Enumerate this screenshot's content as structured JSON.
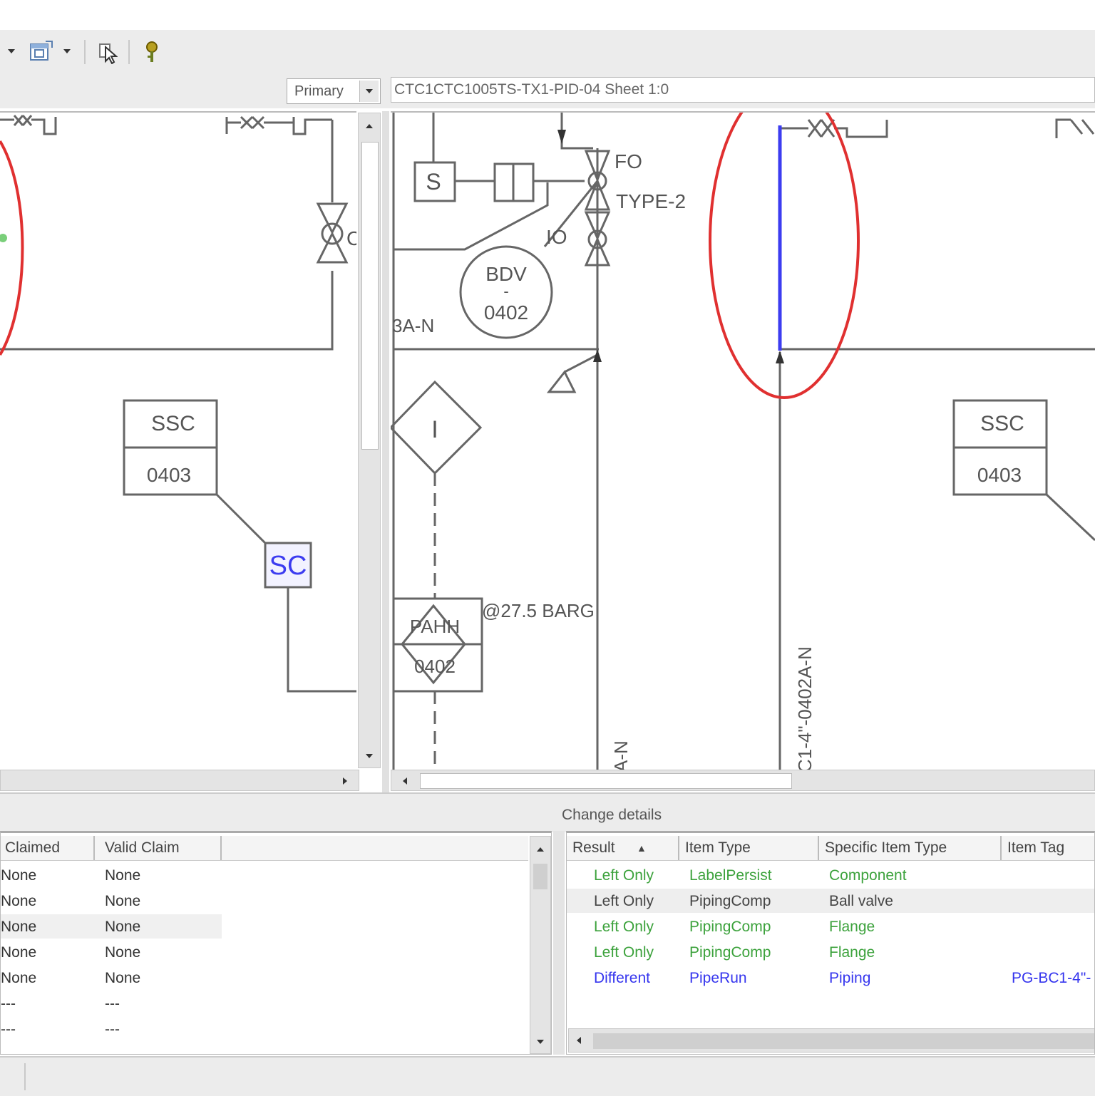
{
  "toolbar": {
    "items": [
      {
        "icon": "dropdown-arrow-icon"
      },
      {
        "icon": "window-compare-icon"
      },
      {
        "icon": "dropdown-arrow-icon"
      },
      {
        "icon": "select-pointer-icon"
      },
      {
        "icon": "pin-marker-icon"
      }
    ]
  },
  "left_pane": {
    "representation_select": "Primary"
  },
  "right_pane": {
    "drawing_title": "CTC1CTC1005TS-TX1-PID-04 Sheet 1:0"
  },
  "drawing_labels": {
    "left": {
      "ssc": "SSC",
      "ssc_num": "0403",
      "sc_box": "SC",
      "valve_tag": "C"
    },
    "right": {
      "s_box": "S",
      "fo": "FO",
      "type2": "TYPE-2",
      "io": "IO",
      "bdv": "BDV",
      "bdv_dash": "-",
      "bdv_num": "0402",
      "line_tag_left": "3A-N",
      "diamond_i": "I",
      "pahh": "PAHH",
      "pahh_num": "0402",
      "pressure": "@27.5 BARG",
      "vertical_tag_1": "A-N",
      "vertical_tag_2": "C1-4\"-0402A-N",
      "ssc": "SSC",
      "ssc_num": "0403"
    }
  },
  "change_details": {
    "title": "Change details",
    "left_table": {
      "columns": [
        "Claimed",
        "Valid Claim"
      ],
      "rows": [
        [
          "None",
          "None"
        ],
        [
          "None",
          "None"
        ],
        [
          "None",
          "None"
        ],
        [
          "None",
          "None"
        ],
        [
          "None",
          "None"
        ],
        [
          "---",
          "---"
        ],
        [
          "---",
          "---"
        ],
        [
          "---",
          "---"
        ]
      ]
    },
    "right_table": {
      "columns": [
        "Result",
        "Item Type",
        "Specific Item Type",
        "Item Tag"
      ],
      "rows": [
        {
          "result": "Left Only",
          "item_type": "LabelPersist",
          "specific": "Component",
          "tag": "",
          "color": "#3ca23c"
        },
        {
          "result": "Left Only",
          "item_type": "PipingComp",
          "specific": "Ball valve",
          "tag": "",
          "color": "#444444"
        },
        {
          "result": "Left Only",
          "item_type": "PipingComp",
          "specific": "Flange",
          "tag": "",
          "color": "#3ca23c"
        },
        {
          "result": "Left Only",
          "item_type": "PipingComp",
          "specific": "Flange",
          "tag": "",
          "color": "#3ca23c"
        },
        {
          "result": "Different",
          "item_type": "PipeRun",
          "specific": "Piping",
          "tag": "PG-BC1-4\"-",
          "color": "#3535ee"
        }
      ]
    }
  },
  "colors": {
    "highlight_ellipse": "#e03030",
    "changed_line": "#3c3cf0",
    "left_only": "#3ca23c",
    "different": "#3535ee"
  }
}
